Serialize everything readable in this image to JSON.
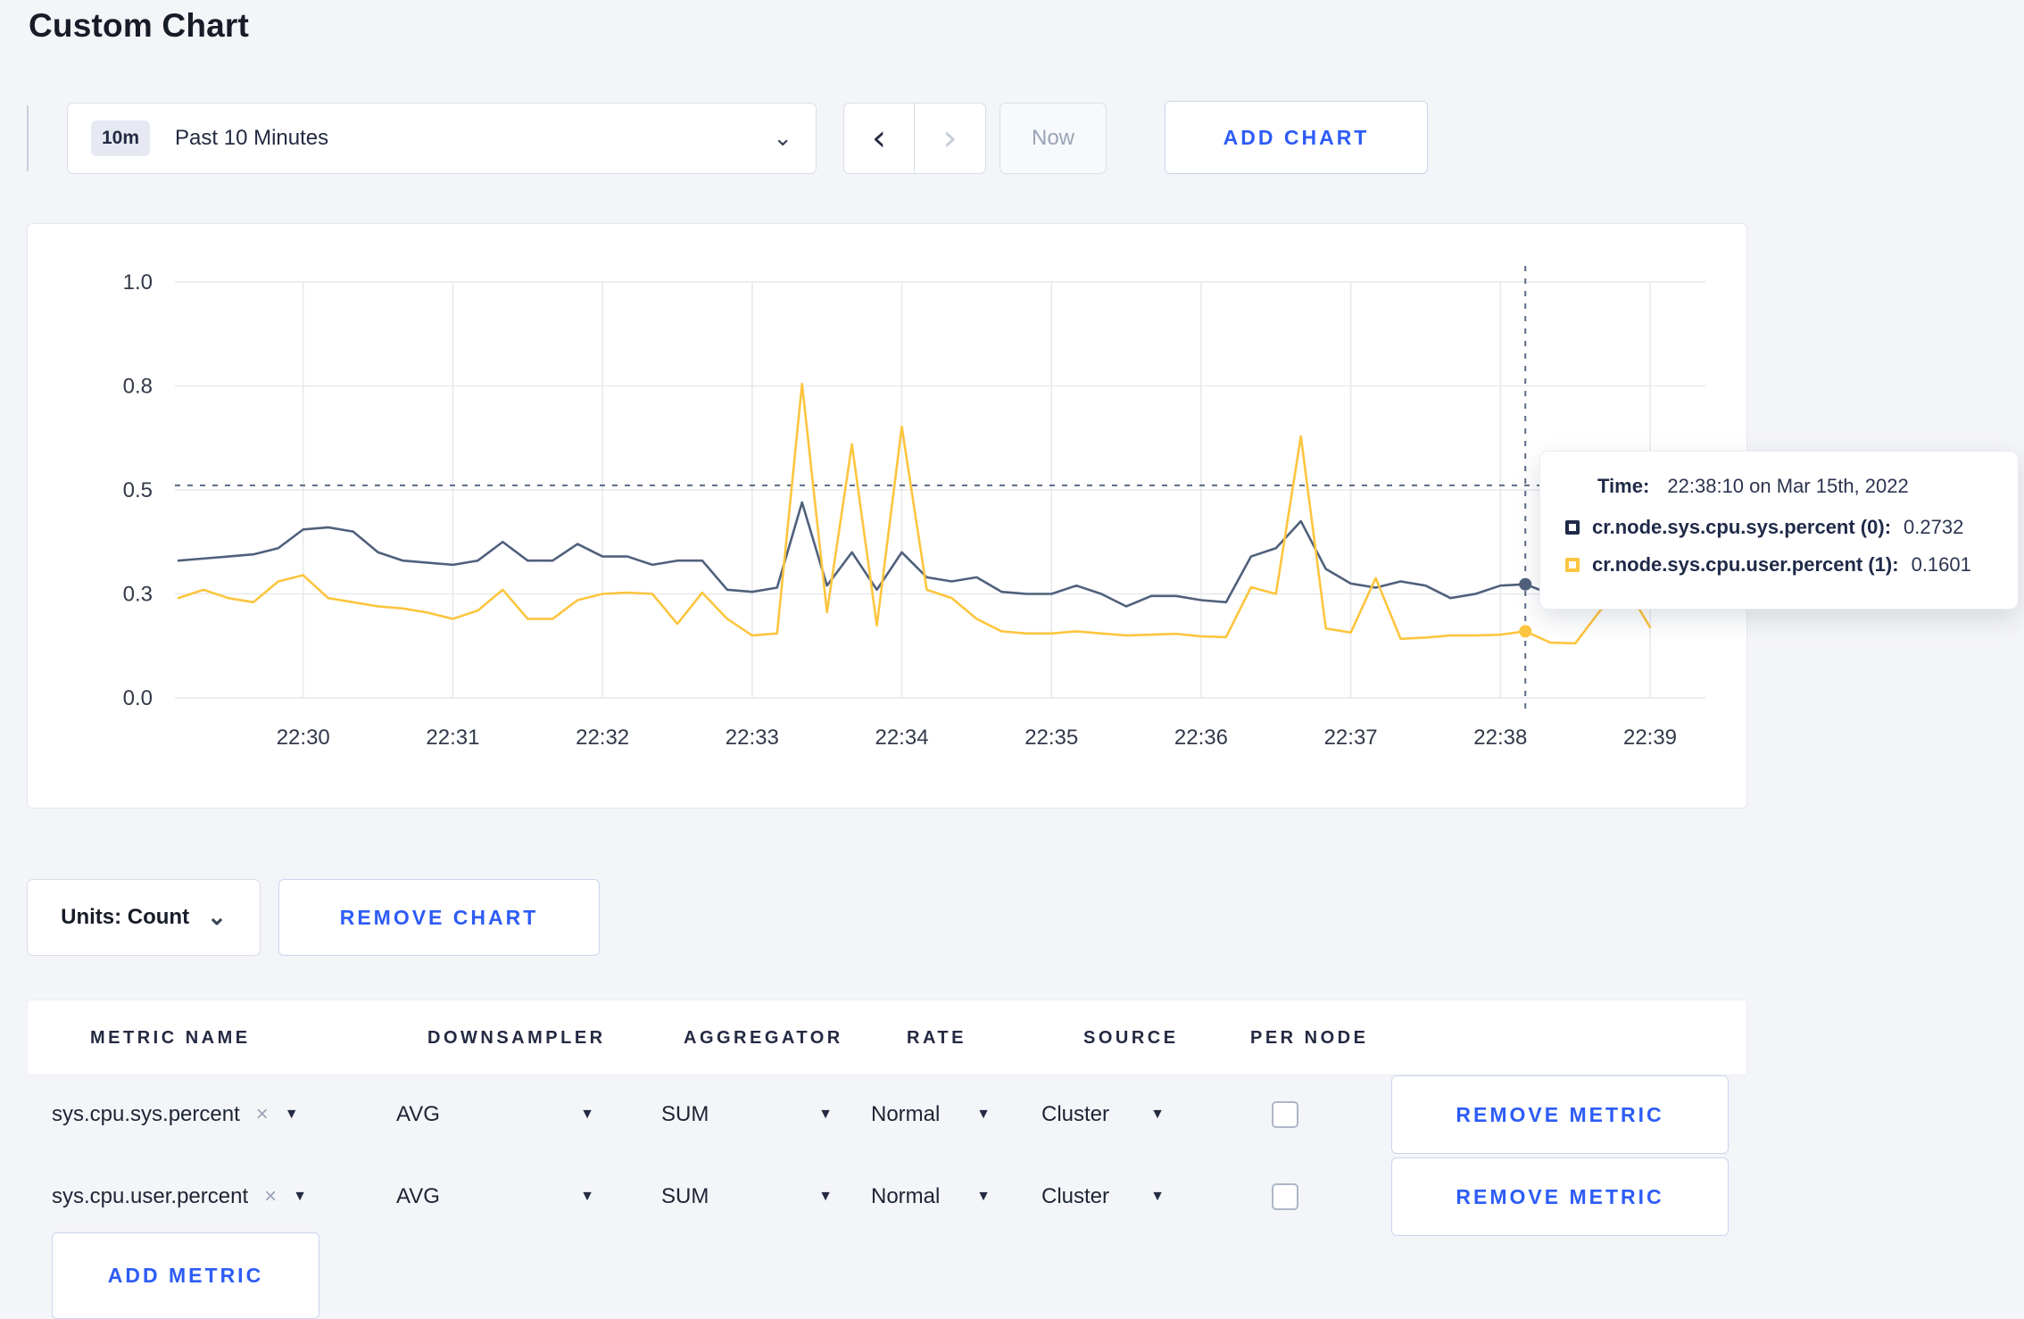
{
  "page": {
    "title": "Custom Chart",
    "background": "#f4f5f8"
  },
  "toolbar": {
    "range_badge": "10m",
    "range_label": "Past 10 Minutes",
    "prev_icon": "‹",
    "next_icon": "›",
    "now_label": "Now",
    "add_chart_label": "ADD CHART"
  },
  "tooltip": {
    "time_label": "Time:",
    "time_value": "22:38:10 on Mar 15th, 2022",
    "series": [
      {
        "name": "cr.node.sys.cpu.sys.percent (0):",
        "value": "0.2732",
        "color": "#1f2a48"
      },
      {
        "name": "cr.node.sys.cpu.user.percent (1):",
        "value": "0.1601",
        "color": "#fdc53f"
      }
    ]
  },
  "units": {
    "label": "Units: Count",
    "remove_chart_label": "REMOVE CHART"
  },
  "metrics_table": {
    "headers": [
      "METRIC NAME",
      "DOWNSAMPLER",
      "AGGREGATOR",
      "RATE",
      "SOURCE",
      "PER NODE"
    ],
    "rows": [
      {
        "metric": "sys.cpu.sys.percent",
        "remove_icon": "×",
        "downsampler": "AVG",
        "aggregator": "SUM",
        "rate": "Normal",
        "source": "Cluster",
        "per_node_checked": false,
        "remove_label": "REMOVE METRIC"
      },
      {
        "metric": "sys.cpu.user.percent",
        "remove_icon": "×",
        "downsampler": "AVG",
        "aggregator": "SUM",
        "rate": "Normal",
        "source": "Cluster",
        "per_node_checked": false,
        "remove_label": "REMOVE METRIC"
      }
    ],
    "add_metric_label": "ADD METRIC"
  },
  "chart_data": {
    "type": "line",
    "title": "",
    "xlabel": "",
    "ylabel": "",
    "x_start": "22:29:10",
    "x_end": "22:39:00",
    "interval_seconds": 10,
    "x_tick_labels": [
      "22:30",
      "22:31",
      "22:32",
      "22:33",
      "22:34",
      "22:35",
      "22:36",
      "22:37",
      "22:38",
      "22:39"
    ],
    "y_ticks": [
      {
        "label": "0.0",
        "value": 0
      },
      {
        "label": "0.3",
        "value": 0.25
      },
      {
        "label": "0.5",
        "value": 0.5
      },
      {
        "label": "0.8",
        "value": 0.75
      },
      {
        "label": "1.0",
        "value": 1.0
      }
    ],
    "ylim": [
      0,
      1
    ],
    "grid": true,
    "legend_position": "tooltip",
    "series": [
      {
        "name": "cr.node.sys.cpu.sys.percent",
        "color": "#50607c",
        "values": [
          0.33,
          0.335,
          0.34,
          0.345,
          0.36,
          0.405,
          0.41,
          0.4,
          0.35,
          0.33,
          0.325,
          0.32,
          0.33,
          0.375,
          0.33,
          0.33,
          0.37,
          0.34,
          0.34,
          0.32,
          0.33,
          0.33,
          0.26,
          0.255,
          0.265,
          0.47,
          0.27,
          0.35,
          0.26,
          0.35,
          0.29,
          0.28,
          0.29,
          0.255,
          0.25,
          0.25,
          0.27,
          0.25,
          0.22,
          0.245,
          0.245,
          0.235,
          0.23,
          0.34,
          0.36,
          0.425,
          0.31,
          0.275,
          0.265,
          0.28,
          0.27,
          0.24,
          0.25,
          0.27,
          0.2732,
          0.25,
          0.26,
          0.27,
          0.28,
          0.3
        ]
      },
      {
        "name": "cr.node.sys.cpu.user.percent",
        "color": "#fdc53f",
        "values": [
          0.24,
          0.26,
          0.24,
          0.23,
          0.28,
          0.295,
          0.24,
          0.23,
          0.22,
          0.215,
          0.205,
          0.19,
          0.21,
          0.26,
          0.19,
          0.19,
          0.235,
          0.25,
          0.253,
          0.25,
          0.178,
          0.253,
          0.19,
          0.15,
          0.155,
          0.755,
          0.206,
          0.61,
          0.174,
          0.652,
          0.26,
          0.24,
          0.19,
          0.16,
          0.155,
          0.155,
          0.16,
          0.155,
          0.15,
          0.152,
          0.154,
          0.148,
          0.146,
          0.266,
          0.25,
          0.629,
          0.167,
          0.157,
          0.288,
          0.142,
          0.145,
          0.15,
          0.15,
          0.152,
          0.1601,
          0.133,
          0.131,
          0.21,
          0.27,
          0.17
        ]
      }
    ],
    "crosshair": {
      "time": "22:38:10",
      "index": 54,
      "y_value": 0.511,
      "color": "#5b6b88"
    },
    "grid_color": "#e8e9ee",
    "axis_text_color": "#33394a"
  }
}
